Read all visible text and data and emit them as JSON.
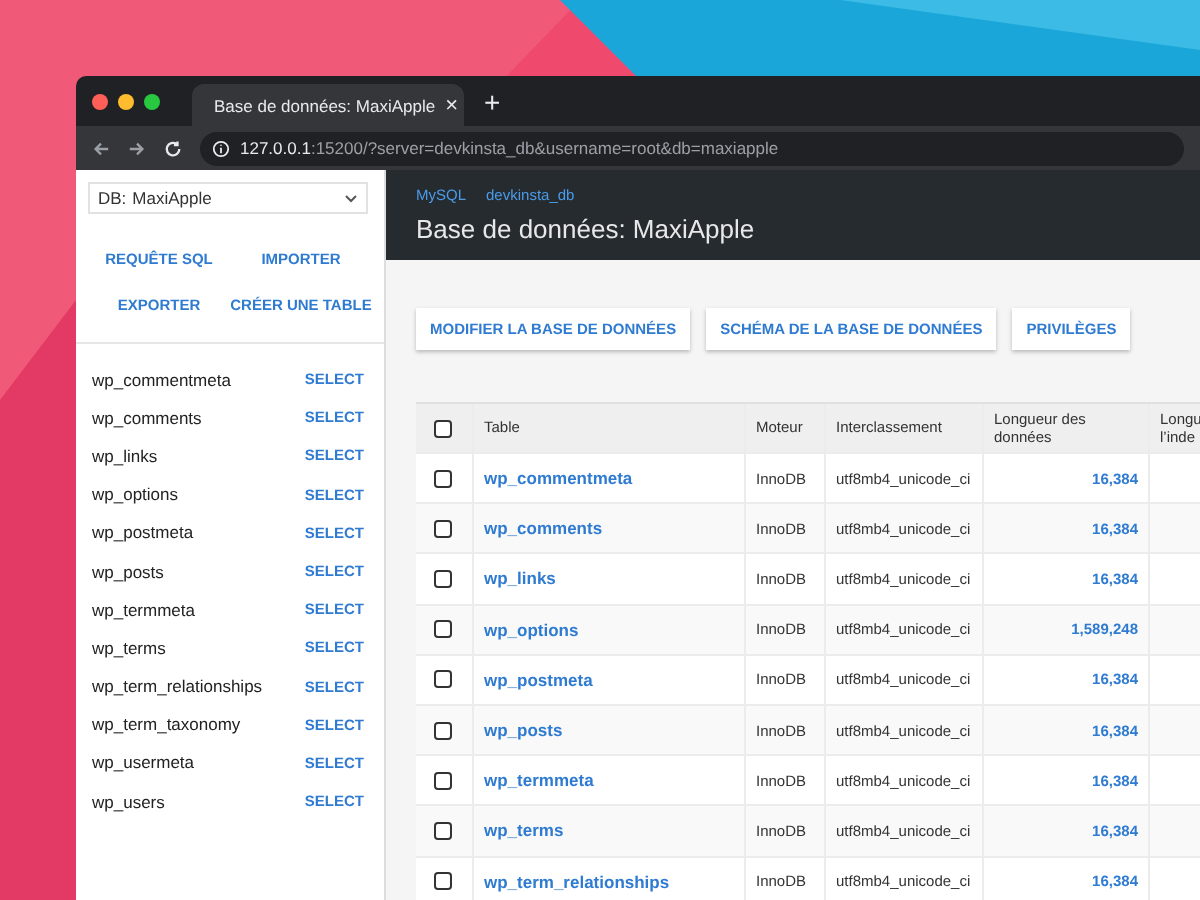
{
  "browser": {
    "tab": {
      "title": "Base de données: MaxiApple",
      "close": "×"
    },
    "new_tab": "+",
    "url": {
      "host": "127.0.0.1",
      "rest": ":15200/?server=devkinsta_db&username=root&db=maxiapple"
    }
  },
  "sidebar": {
    "db_select": {
      "label": "DB:",
      "value": "MaxiApple"
    },
    "actions": [
      "REQUÊTE SQL",
      "IMPORTER",
      "EXPORTER",
      "CRÉER UNE TABLE"
    ],
    "tables": [
      {
        "name": "wp_commentmeta",
        "action": "SELECT"
      },
      {
        "name": "wp_comments",
        "action": "SELECT"
      },
      {
        "name": "wp_links",
        "action": "SELECT"
      },
      {
        "name": "wp_options",
        "action": "SELECT"
      },
      {
        "name": "wp_postmeta",
        "action": "SELECT"
      },
      {
        "name": "wp_posts",
        "action": "SELECT"
      },
      {
        "name": "wp_termmeta",
        "action": "SELECT"
      },
      {
        "name": "wp_terms",
        "action": "SELECT"
      },
      {
        "name": "wp_term_relationships",
        "action": "SELECT"
      },
      {
        "name": "wp_term_taxonomy",
        "action": "SELECT"
      },
      {
        "name": "wp_usermeta",
        "action": "SELECT"
      },
      {
        "name": "wp_users",
        "action": "SELECT"
      }
    ]
  },
  "header": {
    "breadcrumbs": [
      "MySQL",
      "devkinsta_db"
    ],
    "title": "Base de données: MaxiApple"
  },
  "buttons": [
    "MODIFIER LA BASE DE DONNÉES",
    "SCHÉMA DE LA BASE DE DONNÉES",
    "PRIVILÈGES"
  ],
  "table": {
    "select_all": {
      "checked": false
    },
    "columns": [
      {
        "lines": [
          "Table"
        ]
      },
      {
        "lines": [
          "Moteur"
        ]
      },
      {
        "lines": [
          "Interclassement"
        ]
      },
      {
        "lines": [
          "Longueur des",
          "données"
        ]
      },
      {
        "lines": [
          "Longu",
          "l’inde"
        ]
      }
    ],
    "rows": [
      {
        "checked": false,
        "name": "wp_commentmeta",
        "engine": "InnoDB",
        "collation": "utf8mb4_unicode_ci",
        "data_length": "16,384"
      },
      {
        "checked": false,
        "name": "wp_comments",
        "engine": "InnoDB",
        "collation": "utf8mb4_unicode_ci",
        "data_length": "16,384"
      },
      {
        "checked": false,
        "name": "wp_links",
        "engine": "InnoDB",
        "collation": "utf8mb4_unicode_ci",
        "data_length": "16,384"
      },
      {
        "checked": false,
        "name": "wp_options",
        "engine": "InnoDB",
        "collation": "utf8mb4_unicode_ci",
        "data_length": "1,589,248"
      },
      {
        "checked": false,
        "name": "wp_postmeta",
        "engine": "InnoDB",
        "collation": "utf8mb4_unicode_ci",
        "data_length": "16,384"
      },
      {
        "checked": false,
        "name": "wp_posts",
        "engine": "InnoDB",
        "collation": "utf8mb4_unicode_ci",
        "data_length": "16,384"
      },
      {
        "checked": false,
        "name": "wp_termmeta",
        "engine": "InnoDB",
        "collation": "utf8mb4_unicode_ci",
        "data_length": "16,384"
      },
      {
        "checked": false,
        "name": "wp_terms",
        "engine": "InnoDB",
        "collation": "utf8mb4_unicode_ci",
        "data_length": "16,384"
      },
      {
        "checked": false,
        "name": "wp_term_relationships",
        "engine": "InnoDB",
        "collation": "utf8mb4_unicode_ci",
        "data_length": "16,384"
      }
    ]
  }
}
